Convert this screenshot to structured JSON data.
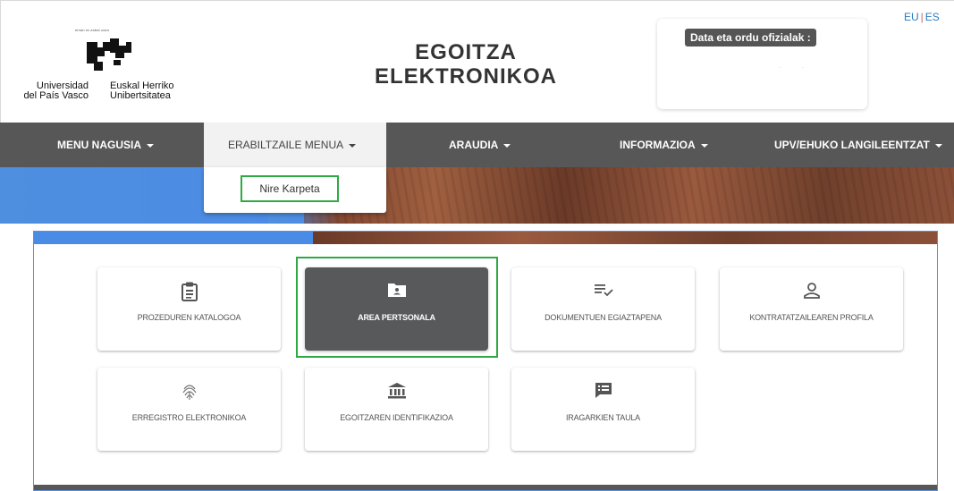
{
  "header": {
    "logo": {
      "motto": "eman ta zabal zazu",
      "left_line1": "Universidad",
      "left_line2": "del País Vasco",
      "right_line1": "Euskal Herriko",
      "right_line2": "Unibertsitatea"
    },
    "title_line1": "EGOITZA",
    "title_line2": "ELEKTRONIKOA",
    "clock_label": "Data eta ordu ofizialak :",
    "languages": [
      "EU",
      "ES"
    ]
  },
  "nav": {
    "items": [
      {
        "label": "MENU NAGUSIA"
      },
      {
        "label": "ERABILTZAILE MENUA",
        "active": true
      },
      {
        "label": "ARAUDIA"
      },
      {
        "label": "INFORMAZIOA"
      },
      {
        "label": "UPV/EHUKO LANGILEENTZAT"
      }
    ],
    "dropdown": {
      "items": [
        {
          "label": "Nire Karpeta"
        }
      ]
    }
  },
  "tiles": [
    {
      "label": "PROZEDUREN KATALOGOA",
      "icon": "clipboard-icon"
    },
    {
      "label": "AREA PERTSONALA",
      "icon": "folder-user-icon",
      "selected": true
    },
    {
      "label": "DOKUMENTUEN EGIAZTAPENA",
      "icon": "list-check-icon"
    },
    {
      "label": "KONTRATATZAILEAREN PROFILA",
      "icon": "person-icon"
    },
    {
      "label": "ERREGISTRO ELEKTRONIKOA",
      "icon": "fingerprint-icon"
    },
    {
      "label": "EGOITZAREN IDENTIFIKAZIOA",
      "icon": "bank-icon"
    },
    {
      "label": "IRAGARKIEN TAULA",
      "icon": "message-board-icon"
    }
  ],
  "colors": {
    "navbar": "#575757",
    "active_tile": "#58595b",
    "highlight": "#2eaa44",
    "banner_blue": "#4a8be5",
    "link": "#2a7bbf"
  }
}
